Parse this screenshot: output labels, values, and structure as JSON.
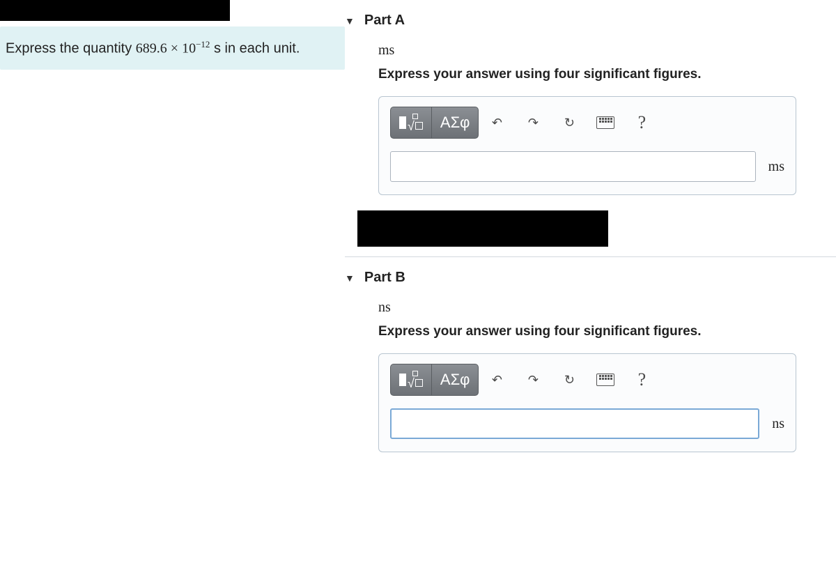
{
  "prompt": {
    "prefix": "Express the quantity ",
    "value": "689.6",
    "times": " × ",
    "base": "10",
    "exp": "−12",
    "suffix": " s in each unit."
  },
  "parts": [
    {
      "title": "Part A",
      "unit": "ms",
      "instruction": "Express your answer using four significant figures.",
      "suffix": "ms",
      "input_border": "blue"
    },
    {
      "title": "Part B",
      "unit": "ns",
      "instruction": "Express your answer using four significant figures.",
      "suffix": "ns",
      "input_border": "blue"
    }
  ],
  "toolbar": {
    "greek": "ΑΣφ",
    "help": "?"
  }
}
